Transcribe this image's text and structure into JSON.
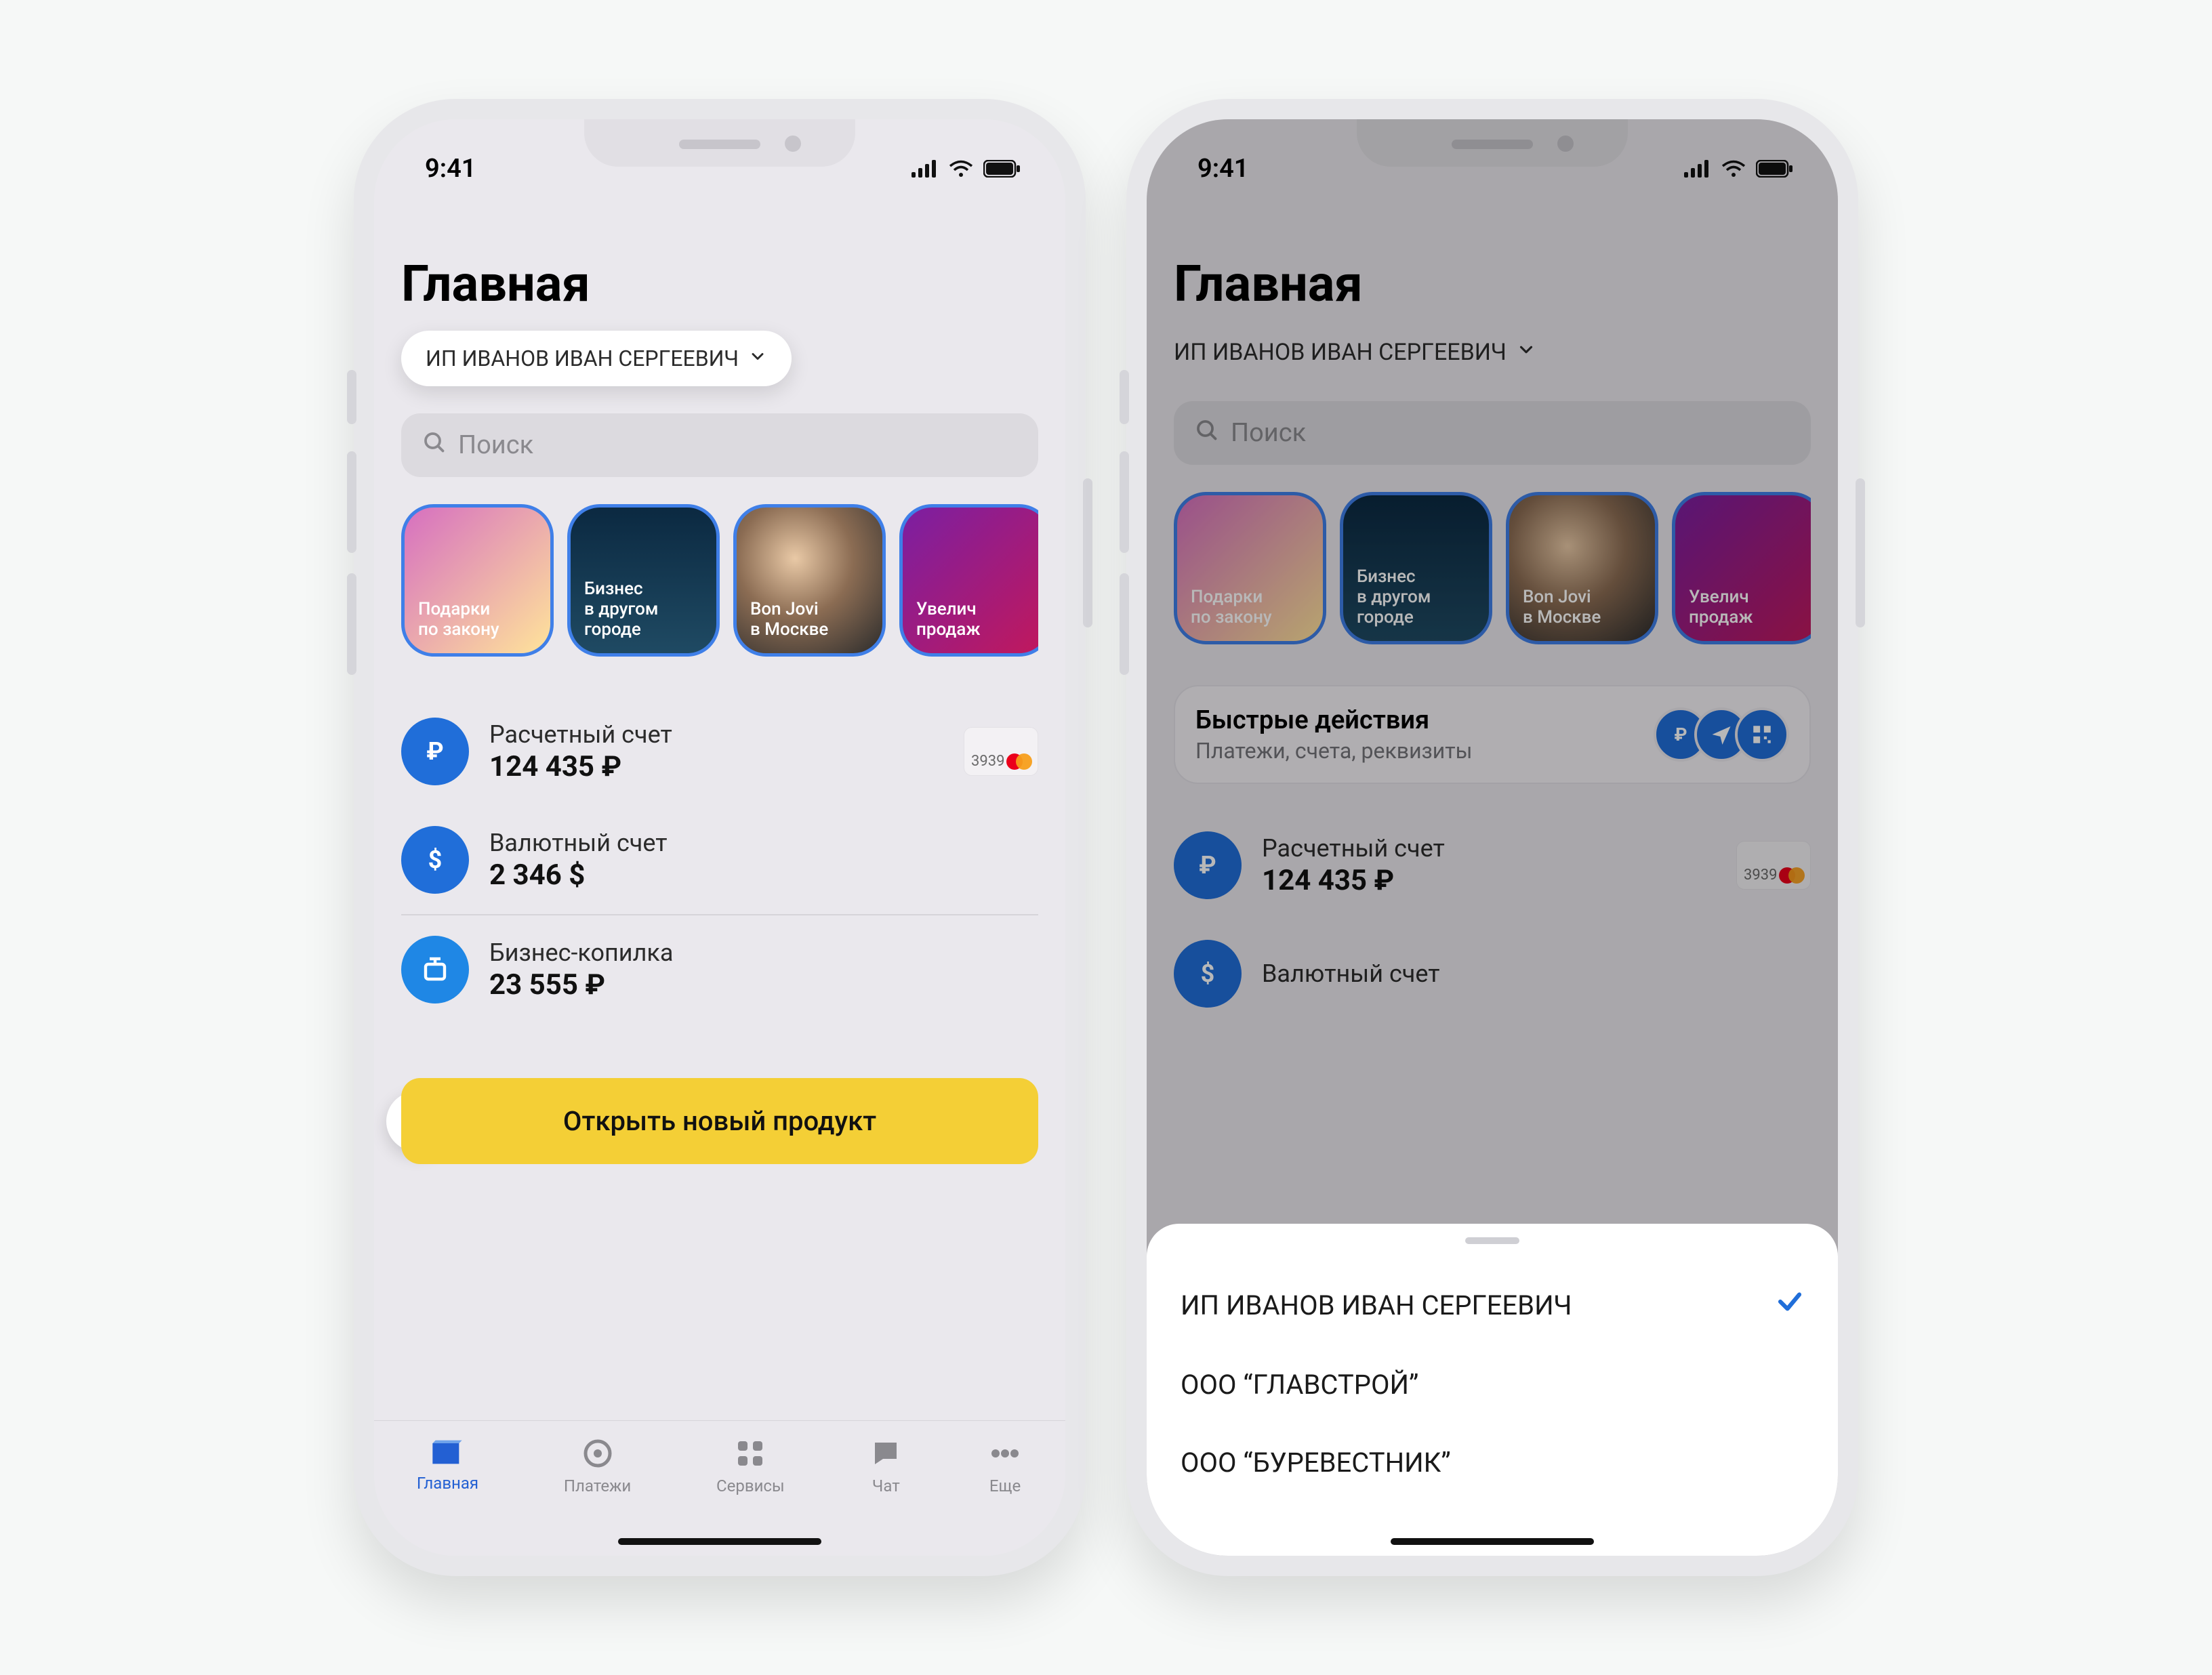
{
  "statusbar": {
    "time": "9:41"
  },
  "header": {
    "title": "Главная",
    "org": "ИП ИВАНОВ ИВАН СЕРГЕЕВИЧ",
    "search_placeholder": "Поиск"
  },
  "stories": [
    {
      "caption": "Подарки\nпо закону"
    },
    {
      "caption": "Бизнес\nв другом\nгороде"
    },
    {
      "caption": "Bon Jovi\nв Москве"
    },
    {
      "caption": "Увелич\nпродаж"
    }
  ],
  "quick_actions": {
    "title": "Быстрые действия",
    "subtitle": "Платежи, счета, реквизиты"
  },
  "accounts": [
    {
      "icon": "ruble",
      "label": "Расчетный счет",
      "value": "124 435 ₽",
      "card_last4": "3939"
    },
    {
      "icon": "dollar",
      "label": "Валютный счет",
      "value": "2 346 $"
    },
    {
      "icon": "piggy",
      "label": "Бизнес-копилка",
      "value": "23 555 ₽"
    }
  ],
  "cta": {
    "label": "Открыть новый продукт"
  },
  "tabs": [
    {
      "label": "Главная",
      "icon": "home",
      "active": true
    },
    {
      "label": "Платежи",
      "icon": "circle"
    },
    {
      "label": "Сервисы",
      "icon": "grid"
    },
    {
      "label": "Чат",
      "icon": "chat"
    },
    {
      "label": "Еще",
      "icon": "dots"
    }
  ],
  "org_picker": [
    {
      "name": "ИП ИВАНОВ ИВАН СЕРГЕЕВИЧ",
      "selected": true
    },
    {
      "name": "ООО “ГЛАВСТРОЙ”"
    },
    {
      "name": "ООО “БУРЕВЕСТНИК”"
    }
  ]
}
